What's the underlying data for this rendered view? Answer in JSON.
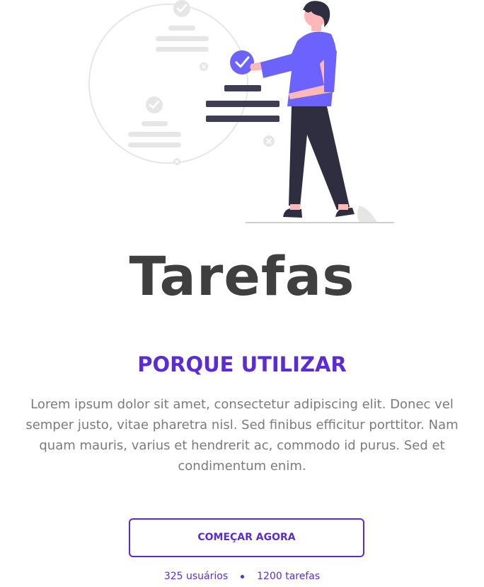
{
  "hero": {
    "illustration": "person-checking-task-list",
    "accent_color": "#6c63ff"
  },
  "app": {
    "title": "Tarefas"
  },
  "intro": {
    "heading": "PORQUE UTILIZAR",
    "text": "Lorem ipsum dolor sit amet, consectetur adipiscing elit. Donec vel semper justo, vitae pharetra nisl. Sed finibus efficitur porttitor. Nam quam mauris, varius et hendrerit ac, commodo id purus. Sed et condimentum enim."
  },
  "cta": {
    "label": "COMEÇAR AGORA"
  },
  "stats": {
    "users": "325 usuários",
    "tasks": "1200 tarefas"
  },
  "colors": {
    "primary": "#5b2bd6",
    "title": "#3f3f3f",
    "body_text": "#7b7b7b"
  }
}
